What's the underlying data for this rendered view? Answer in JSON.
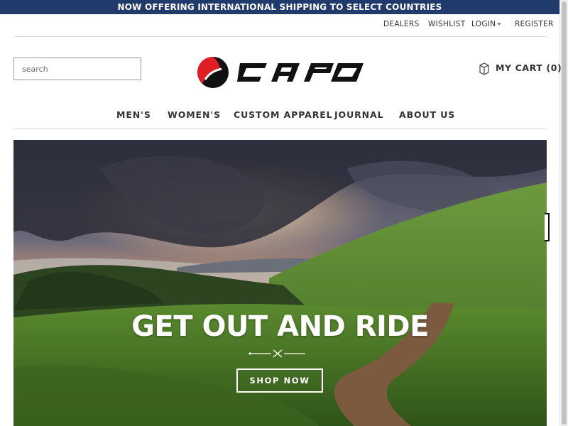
{
  "promo": {
    "text": "NOW OFFERING INTERNATIONAL SHIPPING TO SELECT COUNTRIES"
  },
  "utility_nav": {
    "dealers": "DEALERS",
    "wishlist": "WISHLIST",
    "login": "LOGIN",
    "register": "REGISTER"
  },
  "search": {
    "placeholder": "search"
  },
  "logo": {
    "text": "CAPO",
    "icon": "capo-circle-logo",
    "mark_color": "#e01e24"
  },
  "cart": {
    "label": "MY CART (0)",
    "icon": "shopping-bag-icon"
  },
  "main_nav": {
    "mens": "MEN'S",
    "womens": "WOMEN'S",
    "custom": "CUSTOM APPAREL",
    "journal": "JOURNAL",
    "about": "ABOUT US"
  },
  "hero": {
    "title": "GET OUT AND RIDE",
    "button": "SHOP NOW",
    "ornament_icon": "crossed-cycling-ornament"
  },
  "colors": {
    "promo_bg": "#1f3a6b",
    "text": "#333333",
    "accent_red": "#e01e24"
  }
}
